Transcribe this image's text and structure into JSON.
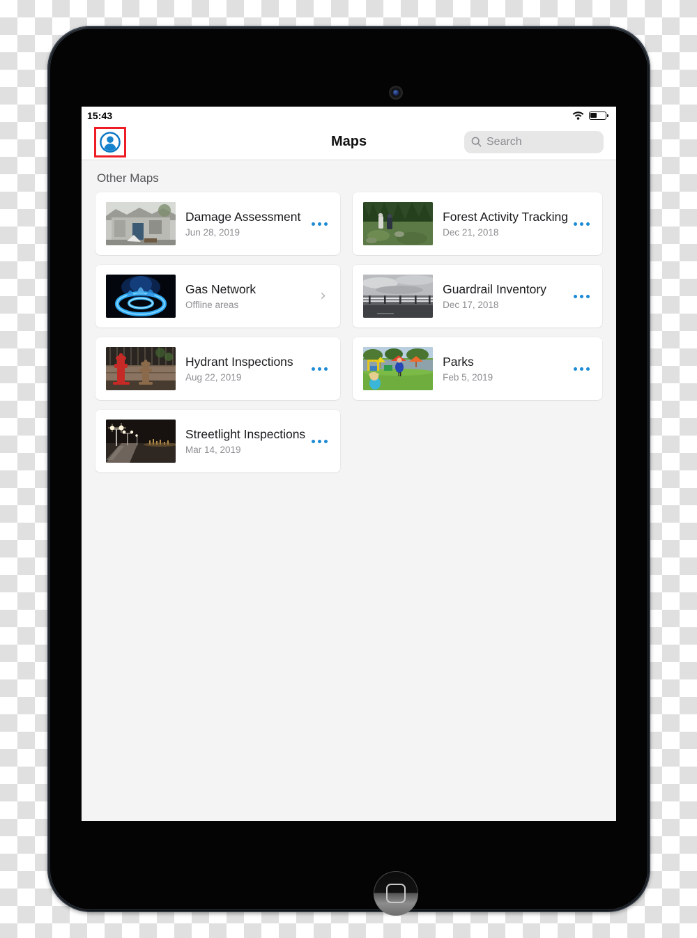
{
  "status_bar": {
    "time": "15:43",
    "wifi_icon": "wifi-icon",
    "battery_icon": "battery-icon",
    "battery_level_percent": 38
  },
  "nav": {
    "profile_icon": "profile-avatar-icon",
    "title": "Maps",
    "search": {
      "icon": "search-icon",
      "placeholder": "Search",
      "value": ""
    }
  },
  "content": {
    "section_title": "Other Maps",
    "maps": [
      {
        "title": "Damage Assessment",
        "subtitle": "Jun 28, 2019",
        "thumbnail": "damaged-house-photo",
        "action": "ellipsis-menu"
      },
      {
        "title": "Forest Activity Tracking",
        "subtitle": "Dec 21, 2018",
        "thumbnail": "forest-workers-photo",
        "action": "ellipsis-menu"
      },
      {
        "title": "Gas Network",
        "subtitle": "Offline areas",
        "thumbnail": "gas-burner-flame-photo",
        "action": "chevron-right"
      },
      {
        "title": "Guardrail Inventory",
        "subtitle": "Dec 17, 2018",
        "thumbnail": "highway-guardrail-photo",
        "action": "ellipsis-menu"
      },
      {
        "title": "Hydrant Inspections",
        "subtitle": "Aug 22, 2019",
        "thumbnail": "fire-hydrants-photo",
        "action": "ellipsis-menu"
      },
      {
        "title": "Parks",
        "subtitle": "Feb 5, 2019",
        "thumbnail": "playground-park-photo",
        "action": "ellipsis-menu"
      },
      {
        "title": "Streetlight Inspections",
        "subtitle": "Mar 14, 2019",
        "thumbnail": "night-streetlights-photo",
        "action": "ellipsis-menu"
      }
    ]
  },
  "device": {
    "camera_icon": "front-camera",
    "home_button_icon": "home-button"
  },
  "colors": {
    "accent_blue": "#1c8ad4",
    "highlight_red": "#ee1c24",
    "screen_background": "#f4f4f4",
    "card_background": "#ffffff",
    "subtitle_grey": "#8d8d92"
  }
}
